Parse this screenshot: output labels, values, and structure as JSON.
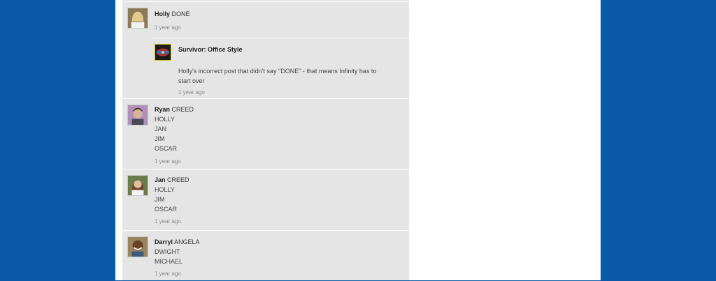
{
  "posts": [
    {
      "author": "Holly",
      "lines": [
        "DONE"
      ],
      "time": "1 year ago",
      "reply": {
        "author": "Survivor: Office Style",
        "text": "Holly's incorrect post that didn't say \"DONE\" - that means Infinity has to start over",
        "time": "1 year ago"
      }
    },
    {
      "author": "Ryan",
      "lines": [
        "CREED",
        "HOLLY",
        "JAN",
        "JIM",
        "OSCAR"
      ],
      "time": "1 year ago"
    },
    {
      "author": "Jan",
      "lines": [
        "CREED",
        "HOLLY",
        "JIM",
        "OSCAR"
      ],
      "time": "1 year ago"
    },
    {
      "author": "Darryl",
      "lines": [
        "ANGELA",
        "DWIGHT",
        "MICHAEL"
      ],
      "time": "1 year ago"
    }
  ],
  "icons": {
    "avatar_holly": "user-photo-icon",
    "avatar_ryan": "user-photo-icon",
    "avatar_jan": "user-photo-icon",
    "avatar_darryl": "user-photo-icon",
    "survivor_logo": "survivor-logo-icon"
  },
  "colors": {
    "page_background": "#0a5aa8",
    "feed_background": "#e5e5e5"
  }
}
